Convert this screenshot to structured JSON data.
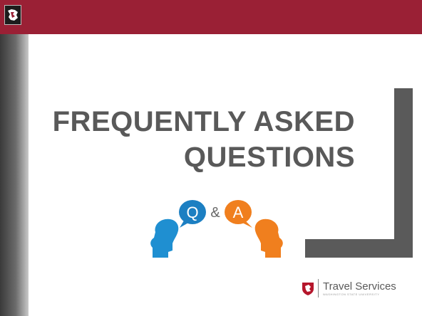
{
  "slide": {
    "title_line1": "FREQUENTLY ASKED",
    "title_line2": "QUESTIONS"
  },
  "qa_image": {
    "letter_q": "Q",
    "ampersand": "&",
    "letter_a": "A"
  },
  "footer": {
    "name": "Travel Services",
    "subtitle": "WASHINGTON STATE UNIVERSITY"
  },
  "colors": {
    "header_band": "#9a2035",
    "title_text": "#595959",
    "bracket": "#5a5a5a",
    "bubble_blue": "#1c7fc2",
    "bubble_orange": "#f07f1e"
  },
  "icons": {
    "header_logo": "wsu-cougar-logo-icon",
    "footer_logo": "wsu-shield-logo-icon"
  }
}
